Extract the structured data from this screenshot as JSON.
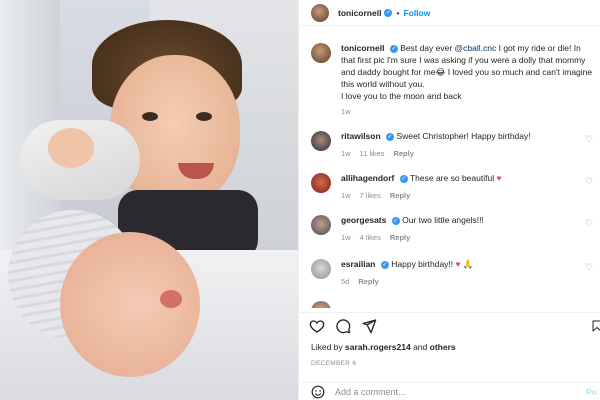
{
  "post": {
    "author": "tonicornell",
    "follow_label": "Follow",
    "dot": "•"
  },
  "caption": {
    "username": "tonicornell",
    "text_before": "Best day ever ",
    "mention": "@cball.cnc",
    "text_after": " I got my ride or die! In that first pic I'm sure I was asking if you were a dolly that mommy and daddy bought for me😂 I loved you so much and can't imagine this world without you.",
    "text_line2": "I love you to the moon and back",
    "time": "1w"
  },
  "comments": [
    {
      "username": "ritawilson",
      "verified": true,
      "text": "Sweet Christopher! Happy birthday!",
      "time": "1w",
      "likes": "11 likes",
      "reply": "Reply"
    },
    {
      "username": "allihagendorf",
      "verified": true,
      "text": "These are so beautiful ",
      "emoji": "♥",
      "time": "1w",
      "likes": "7 likes",
      "reply": "Reply"
    },
    {
      "username": "georgesats",
      "verified": true,
      "text": "Our two little angels!!!",
      "time": "1w",
      "likes": "4 likes",
      "reply": "Reply"
    },
    {
      "username": "esrailian",
      "verified": true,
      "text": "Happy birthday!! ",
      "emoji": "♥ 🙏",
      "time": "5d",
      "reply": "Reply"
    }
  ],
  "likes_line": {
    "prefix": "Liked by ",
    "user": "sarah.rogers214",
    "middle": " and ",
    "others": "others"
  },
  "date": "DECEMBER 6",
  "add_comment": {
    "placeholder": "Add a comment...",
    "post_label": "Po"
  },
  "colors": {
    "link": "#0095f6",
    "verified": "#3897f0",
    "heart": "#ed4956",
    "muted": "#8e8e8e"
  },
  "icons": [
    "heart-icon",
    "comment-icon",
    "share-icon",
    "bookmark-icon",
    "emoji-icon",
    "verified-icon"
  ]
}
